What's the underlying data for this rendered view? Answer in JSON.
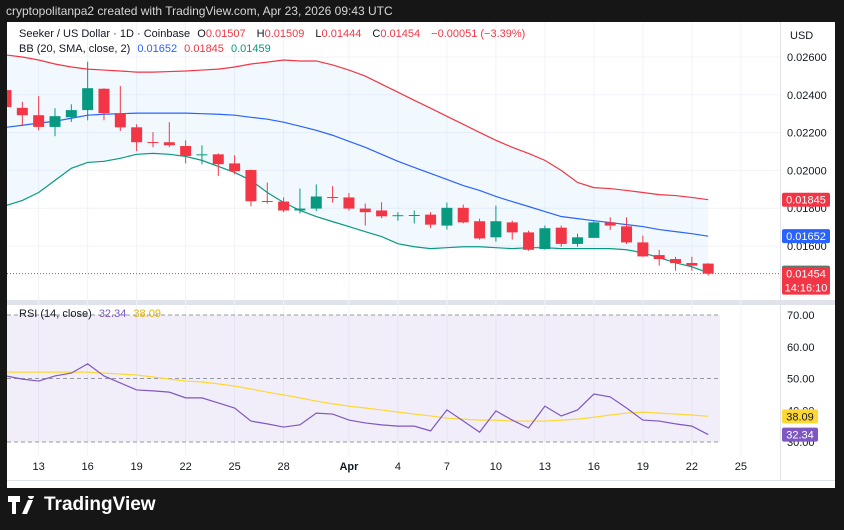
{
  "header": {
    "caption": "cryptopolitanpa2 created with TradingView.com, Apr 23, 2026 09:43 UTC"
  },
  "legend": {
    "symbol": "Seeker / US Dollar · 1D · Coinbase",
    "o_label": "O",
    "o": "0.01507",
    "h_label": "H",
    "h": "0.01509",
    "l_label": "L",
    "l": "0.01444",
    "c_label": "C",
    "c": "0.01454",
    "change": "−0.00051 (−3.39%)",
    "bb_label": "BB (20, SMA, close, 2)",
    "bb_basis": "0.01652",
    "bb_upper": "0.01845",
    "bb_lower": "0.01459",
    "rsi_label": "RSI (14, close)",
    "rsi_value": "32.34",
    "rsi_ma": "38.09"
  },
  "currency": "USD",
  "branding": {
    "name": "TradingView"
  },
  "colors": {
    "up": "#089981",
    "down": "#f23645",
    "basis": "#2962ff",
    "upper": "#f23645",
    "lower": "#089981",
    "rsi": "#7e57c2",
    "rsi_ma": "#fdd835"
  },
  "chart_data": [
    {
      "type": "candlestick",
      "title": "Seeker / US Dollar · 1D · Coinbase",
      "ylim": [
        0.0138,
        0.0268
      ],
      "y_ticks": [
        "0.02600",
        "0.02400",
        "0.02200",
        "0.02000",
        "0.01800",
        "0.01600"
      ],
      "x_ticks": [
        "13",
        "16",
        "19",
        "22",
        "25",
        "28",
        "Apr",
        "4",
        "7",
        "10",
        "13",
        "16",
        "19",
        "22",
        "25"
      ],
      "x_tick_index": [
        2,
        5,
        8,
        11,
        14,
        17,
        21,
        24,
        27,
        30,
        33,
        36,
        39,
        42,
        45
      ],
      "dates": [
        "Mar 11",
        "Mar 12",
        "Mar 13",
        "Mar 14",
        "Mar 15",
        "Mar 16",
        "Mar 17",
        "Mar 18",
        "Mar 19",
        "Mar 20",
        "Mar 21",
        "Mar 22",
        "Mar 23",
        "Mar 24",
        "Mar 25",
        "Mar 26",
        "Mar 27",
        "Mar 28",
        "Mar 29",
        "Mar 30",
        "Mar 31",
        "Apr 1",
        "Apr 2",
        "Apr 3",
        "Apr 4",
        "Apr 5",
        "Apr 6",
        "Apr 7",
        "Apr 8",
        "Apr 9",
        "Apr 10",
        "Apr 11",
        "Apr 12",
        "Apr 13",
        "Apr 14",
        "Apr 15",
        "Apr 16",
        "Apr 17",
        "Apr 18",
        "Apr 19",
        "Apr 20",
        "Apr 21",
        "Apr 22",
        "Apr 23"
      ],
      "ohlc": [
        [
          0.02425,
          0.02435,
          0.02329,
          0.02335
        ],
        [
          0.02331,
          0.02363,
          0.02234,
          0.02292
        ],
        [
          0.02292,
          0.02393,
          0.02212,
          0.0223
        ],
        [
          0.0223,
          0.02329,
          0.02181,
          0.02287
        ],
        [
          0.02281,
          0.0235,
          0.02256,
          0.02319
        ],
        [
          0.02319,
          0.02575,
          0.02265,
          0.02435
        ],
        [
          0.02432,
          0.02435,
          0.02265,
          0.02303
        ],
        [
          0.02303,
          0.02446,
          0.02209,
          0.02228
        ],
        [
          0.02228,
          0.02244,
          0.02102,
          0.02149
        ],
        [
          0.0215,
          0.02202,
          0.02122,
          0.02149
        ],
        [
          0.02149,
          0.02255,
          0.02124,
          0.02133
        ],
        [
          0.02129,
          0.02159,
          0.02037,
          0.02076
        ],
        [
          0.02082,
          0.02133,
          0.02032,
          0.02085
        ],
        [
          0.02085,
          0.0209,
          0.0197,
          0.02033
        ],
        [
          0.02037,
          0.0208,
          0.01979,
          0.01996
        ],
        [
          0.02002,
          0.02005,
          0.0181,
          0.01837
        ],
        [
          0.01838,
          0.01936,
          0.01825,
          0.01835
        ],
        [
          0.01835,
          0.01857,
          0.01779,
          0.01788
        ],
        [
          0.01788,
          0.01904,
          0.01772,
          0.01798
        ],
        [
          0.01798,
          0.01926,
          0.01784,
          0.01862
        ],
        [
          0.01859,
          0.01917,
          0.0183,
          0.01857
        ],
        [
          0.01857,
          0.0188,
          0.01788,
          0.01798
        ],
        [
          0.01798,
          0.01825,
          0.01708,
          0.01779
        ],
        [
          0.01788,
          0.01832,
          0.01747,
          0.01757
        ],
        [
          0.01759,
          0.01779,
          0.01734,
          0.01763
        ],
        [
          0.01761,
          0.01788,
          0.01719,
          0.01764
        ],
        [
          0.01766,
          0.01779,
          0.01694,
          0.01713
        ],
        [
          0.01708,
          0.0183,
          0.01687,
          0.01802
        ],
        [
          0.01802,
          0.01819,
          0.0172,
          0.01725
        ],
        [
          0.01731,
          0.01745,
          0.01634,
          0.0164
        ],
        [
          0.01646,
          0.01814,
          0.01623,
          0.01731
        ],
        [
          0.01725,
          0.01734,
          0.01634,
          0.01672
        ],
        [
          0.01672,
          0.01681,
          0.01575,
          0.0158
        ],
        [
          0.01584,
          0.01708,
          0.0158,
          0.01694
        ],
        [
          0.01697,
          0.01708,
          0.01596,
          0.01611
        ],
        [
          0.01611,
          0.01665,
          0.01596,
          0.01646
        ],
        [
          0.01643,
          0.01731,
          0.01643,
          0.01725
        ],
        [
          0.01725,
          0.01752,
          0.01685,
          0.01708
        ],
        [
          0.01704,
          0.01752,
          0.01611,
          0.01619
        ],
        [
          0.01619,
          0.01655,
          0.01543,
          0.01545
        ],
        [
          0.01552,
          0.0158,
          0.01496,
          0.01531
        ],
        [
          0.01531,
          0.01543,
          0.01469,
          0.0151
        ],
        [
          0.0151,
          0.01543,
          0.01469,
          0.01496
        ],
        [
          0.01507,
          0.01509,
          0.01444,
          0.01454
        ]
      ],
      "bb_upper": [
        0.02611,
        0.026,
        0.02584,
        0.02563,
        0.02547,
        0.02536,
        0.02531,
        0.02526,
        0.0252,
        0.0252,
        0.02523,
        0.02526,
        0.02531,
        0.02536,
        0.02547,
        0.02563,
        0.02573,
        0.02584,
        0.02579,
        0.02579,
        0.02558,
        0.02531,
        0.02499,
        0.02456,
        0.02414,
        0.02371,
        0.02329,
        0.02286,
        0.02244,
        0.02201,
        0.02159,
        0.02122,
        0.0209,
        0.02053,
        0.02,
        0.01936,
        0.01909,
        0.01904,
        0.01894,
        0.01883,
        0.01872,
        0.01867,
        0.01857,
        0.01845
      ],
      "bb_basis": [
        0.02228,
        0.02239,
        0.0225,
        0.0226,
        0.02276,
        0.02292,
        0.02297,
        0.023,
        0.02303,
        0.02303,
        0.02303,
        0.02303,
        0.023,
        0.02297,
        0.02292,
        0.02281,
        0.02271,
        0.02255,
        0.02234,
        0.02212,
        0.02186,
        0.02154,
        0.02122,
        0.02085,
        0.02048,
        0.02016,
        0.01984,
        0.01952,
        0.0192,
        0.01894,
        0.01862,
        0.01835,
        0.01809,
        0.01782,
        0.01756,
        0.01745,
        0.01734,
        0.01724,
        0.01713,
        0.01703,
        0.01687,
        0.01676,
        0.01665,
        0.01652
      ],
      "bb_lower": [
        0.01814,
        0.01841,
        0.01883,
        0.01947,
        0.02011,
        0.02042,
        0.02048,
        0.02064,
        0.02085,
        0.0209,
        0.02085,
        0.02074,
        0.02053,
        0.02021,
        0.01989,
        0.01947,
        0.01883,
        0.0183,
        0.01788,
        0.01756,
        0.01729,
        0.01703,
        0.01676,
        0.0165,
        0.01612,
        0.01596,
        0.01586,
        0.01591,
        0.01596,
        0.01596,
        0.01591,
        0.01586,
        0.01591,
        0.01591,
        0.01586,
        0.01586,
        0.01586,
        0.01586,
        0.0158,
        0.01564,
        0.01538,
        0.01511,
        0.0149,
        0.01459
      ],
      "price_labels": [
        {
          "text": "0.01845",
          "value": 0.01845,
          "color": "#f23645"
        },
        {
          "text": "0.01652",
          "value": 0.01652,
          "color": "#2962ff"
        },
        {
          "text": "0.01459",
          "value": 0.01459,
          "color": "#089981"
        },
        {
          "text": "0.01454",
          "value": 0.01454,
          "color": "#f23645",
          "sub": "14:16:10"
        }
      ]
    },
    {
      "type": "line",
      "title": "RSI (14, close)",
      "ylim": [
        27,
        72
      ],
      "y_ticks": [
        "70.00",
        "60.00",
        "50.00",
        "40.00",
        "30.00"
      ],
      "bands": [
        30,
        50,
        70
      ],
      "rsi": [
        50.8,
        49.8,
        49.2,
        50.8,
        51.7,
        54.6,
        50.8,
        48.6,
        46.4,
        46.1,
        45.7,
        43.9,
        43.9,
        42.3,
        40.7,
        36.6,
        35.7,
        34.7,
        35.4,
        39.1,
        38.8,
        36.9,
        36.0,
        35.4,
        35.0,
        35.0,
        33.5,
        40.1,
        36.6,
        33.1,
        39.8,
        36.9,
        34.4,
        41.3,
        38.2,
        40.1,
        45.1,
        44.2,
        40.7,
        36.9,
        36.6,
        35.7,
        35.0,
        32.34
      ],
      "rsi_ma": [
        52.0,
        52.0,
        52.0,
        52.0,
        52.0,
        52.0,
        51.7,
        51.4,
        51.1,
        50.5,
        49.8,
        49.2,
        48.9,
        48.3,
        47.6,
        46.7,
        45.7,
        44.8,
        43.9,
        42.9,
        42.0,
        41.3,
        40.7,
        40.1,
        39.4,
        38.8,
        38.2,
        37.5,
        37.2,
        36.9,
        36.9,
        36.6,
        36.6,
        36.6,
        36.9,
        37.2,
        37.8,
        38.5,
        39.1,
        39.4,
        39.1,
        38.8,
        38.5,
        38.09
      ],
      "value_labels": [
        {
          "text": "38.09",
          "value": 38.09,
          "color": "#fdd835"
        },
        {
          "text": "32.34",
          "value": 32.34,
          "color": "#7e57c2"
        }
      ]
    }
  ]
}
